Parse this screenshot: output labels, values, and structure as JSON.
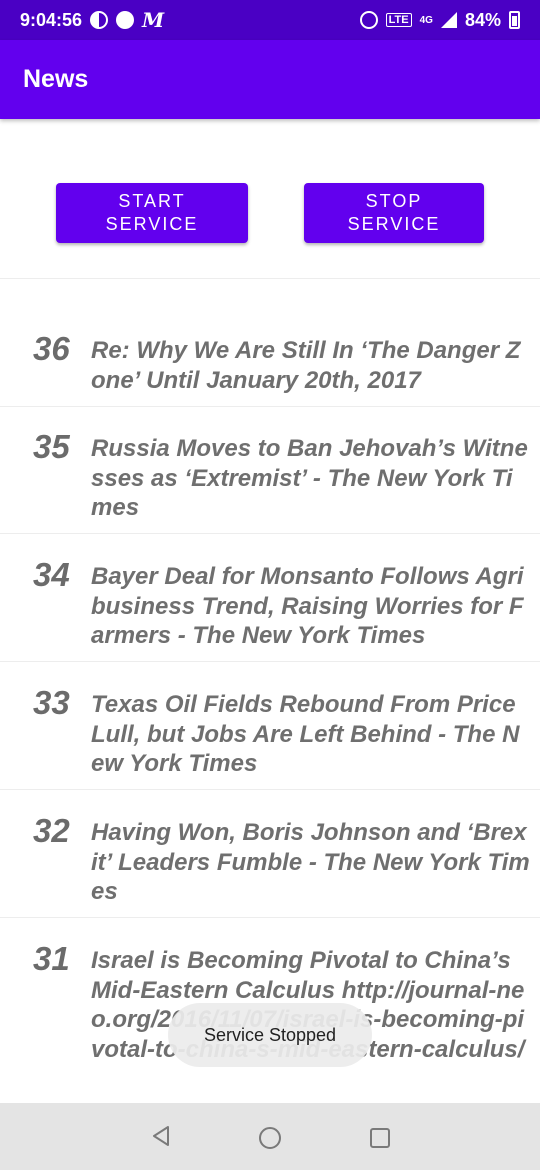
{
  "status_bar": {
    "time": "9:04:56",
    "network": "4G",
    "battery": "84%"
  },
  "app_bar": {
    "title": "News"
  },
  "buttons": {
    "start": "START\nSERVICE",
    "stop": "STOP\nSERVICE"
  },
  "news": [
    {
      "num": "36",
      "title": "Re: Why We Are Still In ‘The Danger Zone’ Until January 20th, 2017"
    },
    {
      "num": "35",
      "title": "Russia Moves to Ban Jehovah’s Witnesses as ‘Extremist’ - The New York Times"
    },
    {
      "num": "34",
      "title": "Bayer Deal for Monsanto Follows Agribusiness Trend, Raising Worries for Farmers - The New York Times"
    },
    {
      "num": "33",
      "title": "Texas Oil Fields Rebound From Price Lull, but Jobs Are Left Behind - The New York Times"
    },
    {
      "num": "32",
      "title": "Having Won, Boris Johnson and ‘Brexit’ Leaders Fumble - The New York Times"
    },
    {
      "num": "31",
      "title": "Israel is Becoming Pivotal to China’s Mid-Eastern Calculus http://journal-neo.org/2016/11/07/israel-is-becoming-pivotal-to-china-s-mid-eastern-calculus/"
    }
  ],
  "toast": "Service Stopped",
  "colors": {
    "primary": "#6200ee",
    "primary_dark": "#4a00c4",
    "text_grey": "#6f6f6f"
  }
}
